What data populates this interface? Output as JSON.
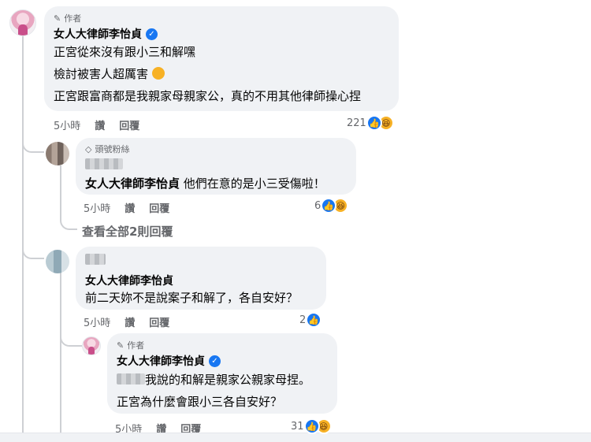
{
  "comment1": {
    "badge": "作者",
    "author": "女人大律師李怡貞",
    "paragraphs": [
      "正宮從來沒有跟小三和解嘿",
      "檢討被害人超厲害",
      "正宮跟富商都是我親家母親家公，真的不用其他律師操心捏"
    ],
    "emoji_icon": "smiling-face-icon",
    "time": "5小時",
    "like_label": "讚",
    "reply_label": "回覆",
    "reaction_count": "221"
  },
  "reply1": {
    "badge": "頭號粉絲",
    "author": "女人大律師李怡貞",
    "text": "他們在意的是小三受傷啦！",
    "time": "5小時",
    "like_label": "讚",
    "reply_label": "回覆",
    "reaction_count": "6"
  },
  "view_all_replies": "查看全部2則回覆",
  "comment2": {
    "author": "女人大律師李怡貞",
    "text": "前二天妳不是說案子和解了，各自安好？",
    "time": "5小時",
    "like_label": "讚",
    "reply_label": "回覆",
    "reaction_count": "2"
  },
  "reply2": {
    "badge": "作者",
    "author": "女人大律師李怡貞",
    "line1": "我說的和解是親家公親家母捏。",
    "line2": "正宮為什麼會跟小三各自安好？",
    "time": "5小時",
    "like_label": "讚",
    "reply_label": "回覆",
    "reaction_count": "31"
  },
  "colors": {
    "bubble": "#f0f2f5",
    "facebook_blue": "#1877f2",
    "secondary_text": "#65676b",
    "thread_line": "#ced0d4"
  },
  "icons": [
    "pencil-icon",
    "verified-icon",
    "diamond-icon",
    "like-reaction-icon",
    "haha-reaction-icon"
  ]
}
